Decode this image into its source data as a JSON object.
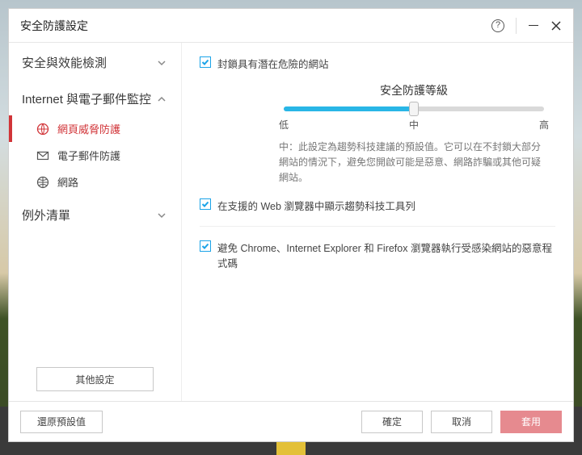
{
  "window": {
    "title": "安全防護設定"
  },
  "sidebar": {
    "sections": [
      {
        "label": "安全與效能檢測",
        "expanded": false
      },
      {
        "label": "Internet 與電子郵件監控",
        "expanded": true
      },
      {
        "label": "例外清單",
        "expanded": false
      }
    ],
    "items": [
      {
        "label": "網頁威脅防護",
        "active": true,
        "icon": "globe-shield"
      },
      {
        "label": "電子郵件防護",
        "active": false,
        "icon": "envelope"
      },
      {
        "label": "網路",
        "active": false,
        "icon": "net-globe"
      }
    ],
    "other_settings": "其他設定"
  },
  "main": {
    "check1": "封鎖具有潛在危險的網站",
    "slider": {
      "title": "安全防護等級",
      "low": "低",
      "mid": "中",
      "high": "高",
      "desc": "中：此設定為趨勢科技建議的預設值。它可以在不封鎖大部分網站的情況下，避免您開啟可能是惡意、網路詐騙或其他可疑網站。"
    },
    "check2": "在支援的 Web 瀏覽器中顯示趨勢科技工具列",
    "check3": "避免 Chrome、Internet Explorer 和 Firefox 瀏覽器執行受感染網站的惡意程式碼"
  },
  "footer": {
    "restore": "還原預設值",
    "ok": "確定",
    "cancel": "取消",
    "apply": "套用"
  }
}
